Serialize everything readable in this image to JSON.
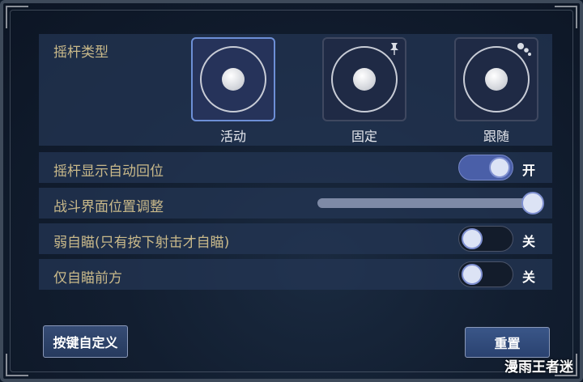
{
  "stick_type": {
    "label": "摇杆类型",
    "options": [
      {
        "label": "活动",
        "selected": true,
        "icon": "none"
      },
      {
        "label": "固定",
        "selected": false,
        "icon": "pin-icon"
      },
      {
        "label": "跟随",
        "selected": false,
        "icon": "dots-icon"
      }
    ]
  },
  "settings": {
    "auto_return": {
      "label": "摇杆显示自动回位",
      "state": "开",
      "on": true
    },
    "position_adjust": {
      "label": "战斗界面位置调整",
      "value": 1.0
    },
    "weak_aim": {
      "label": "弱自瞄(只有按下射击才自瞄)",
      "state": "关",
      "on": false
    },
    "front_aim": {
      "label": "仅自瞄前方",
      "state": "关",
      "on": false
    }
  },
  "buttons": {
    "custom": "按键自定义",
    "reset": "重置"
  },
  "watermark": "漫雨王者迷",
  "colors": {
    "label_gold": "#c9b98a",
    "accent_blue": "#4a5fa8",
    "row_bg": "#243654"
  }
}
